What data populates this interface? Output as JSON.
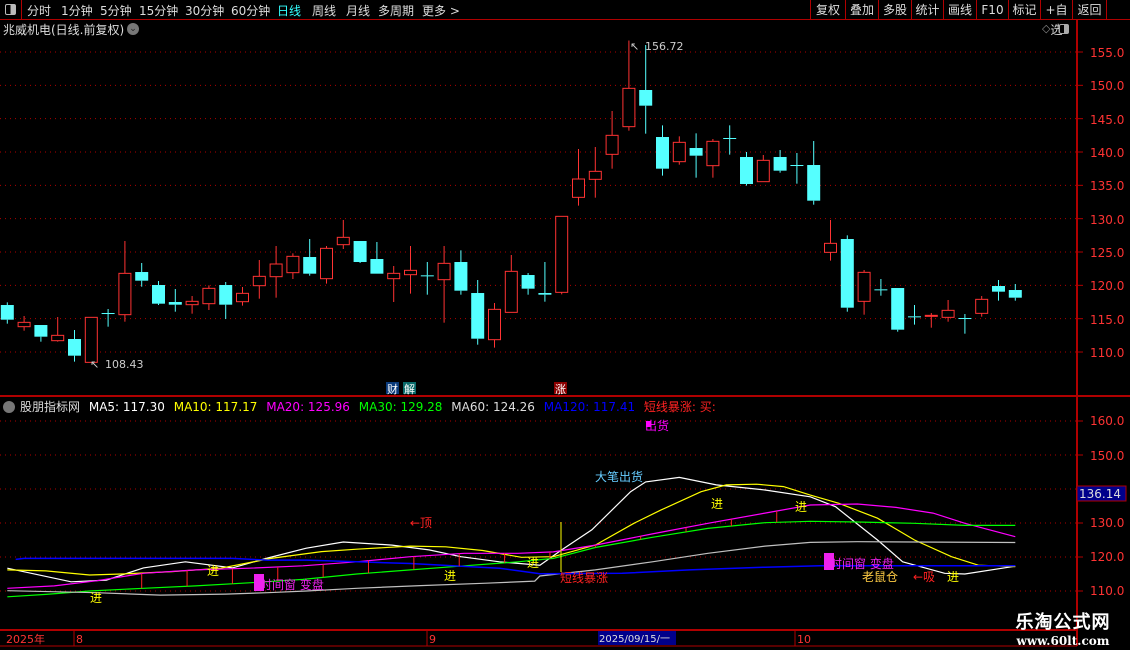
{
  "toolbar": {
    "periods": [
      "分时",
      "1分钟",
      "5分钟",
      "15分钟",
      "30分钟",
      "60分钟",
      "日线",
      "周线",
      "月线",
      "多周期",
      "更多 >"
    ],
    "active_period": "日线",
    "buttons": [
      "复权",
      "叠加",
      "多股",
      "统计",
      "画线",
      "F10",
      "标记",
      "+自选",
      "返回"
    ]
  },
  "main": {
    "title": "兆威机电(日线.前复权)",
    "high_label": "156.72",
    "low_label": "108.43",
    "event_badges": [
      "财",
      "解",
      "涨"
    ],
    "axis_ticks": [
      "155.0",
      "150.0",
      "145.0",
      "140.0",
      "135.0",
      "130.0",
      "125.0",
      "120.0",
      "115.0",
      "110.0"
    ]
  },
  "indicator": {
    "name": "股朋指标网",
    "ma": [
      {
        "label": "MA5: 117.30",
        "color": "#ffffff"
      },
      {
        "label": "MA10: 117.17",
        "color": "#ffff00"
      },
      {
        "label": "MA20: 125.96",
        "color": "#ff00ff"
      },
      {
        "label": "MA30: 129.28",
        "color": "#00ff00"
      },
      {
        "label": "MA60: 124.26",
        "color": "#c0c0c0"
      },
      {
        "label": "MA120: 117.41",
        "color": "#0000ff"
      }
    ],
    "signal_label": "短线暴涨: 买:",
    "axis_ticks": [
      "160.0",
      "150.0",
      "140.0",
      "130.0",
      "120.0",
      "110.0"
    ],
    "cursor_value": "136.14",
    "annotations": {
      "chu_huo": "出货",
      "da_bi_chu_huo": "大笔出货",
      "ding": "←顶",
      "jin": "进",
      "shi_jian_chuang": "时间窗 变盘",
      "duan_xian_bao_zhang": "短线暴涨",
      "lao_shu_cang": "老鼠仓",
      "xi": "←吸"
    }
  },
  "time_axis": {
    "year": "2025年",
    "months": [
      "8",
      "9",
      "10"
    ],
    "cursor_date": "2025/09/15/一"
  },
  "watermark": {
    "line1": "乐淘公式网",
    "line2": "www.60lt.com"
  },
  "colors": {
    "up": "#ff3333",
    "down": "#55ffff",
    "grid": "#b00000",
    "axis_text": "#ff3333",
    "cursor_box": "#00008b"
  },
  "chart_data": [
    {
      "type": "candlestick",
      "title": "兆威机电(日线.前复权)",
      "ylim": [
        105,
        158
      ],
      "fields": [
        "open",
        "high",
        "low",
        "close"
      ],
      "candles": [
        [
          117.05,
          117.45,
          114.25,
          114.85
        ],
        [
          113.8,
          115.4,
          113.2,
          114.45
        ],
        [
          114.05,
          114.05,
          111.55,
          112.3
        ],
        [
          111.7,
          115.25,
          111.55,
          112.5
        ],
        [
          111.95,
          113.3,
          108.55,
          109.45
        ],
        [
          108.45,
          115.2,
          108.43,
          115.2
        ],
        [
          115.85,
          116.45,
          113.8,
          115.75
        ],
        [
          115.6,
          126.65,
          114.55,
          121.8
        ],
        [
          122.0,
          123.35,
          119.8,
          120.7
        ],
        [
          120.05,
          120.65,
          117.05,
          117.25
        ],
        [
          117.5,
          119.45,
          116.05,
          117.1
        ],
        [
          117.1,
          118.4,
          115.75,
          117.6
        ],
        [
          117.25,
          120.0,
          116.3,
          119.55
        ],
        [
          120.05,
          120.5,
          114.95,
          117.1
        ],
        [
          117.55,
          119.75,
          116.95,
          118.8
        ],
        [
          119.95,
          123.8,
          118.0,
          121.35
        ],
        [
          121.3,
          125.9,
          118.15,
          123.2
        ],
        [
          121.9,
          124.8,
          120.95,
          124.35
        ],
        [
          124.25,
          126.95,
          121.45,
          121.75
        ],
        [
          121.0,
          125.9,
          120.25,
          125.55
        ],
        [
          126.1,
          129.8,
          125.45,
          127.2
        ],
        [
          126.65,
          126.65,
          123.35,
          123.5
        ],
        [
          123.95,
          126.5,
          121.75,
          121.75
        ],
        [
          121.0,
          122.9,
          117.5,
          121.8
        ],
        [
          121.6,
          125.9,
          118.75,
          122.25
        ],
        [
          121.5,
          123.5,
          118.6,
          121.4
        ],
        [
          120.85,
          125.9,
          114.4,
          123.3
        ],
        [
          123.5,
          125.25,
          118.6,
          119.2
        ],
        [
          118.85,
          120.8,
          111.1,
          112.0
        ],
        [
          111.85,
          117.35,
          110.65,
          116.4
        ],
        [
          115.95,
          124.55,
          115.95,
          122.1
        ],
        [
          121.55,
          121.85,
          118.6,
          119.5
        ],
        [
          118.85,
          123.5,
          117.55,
          118.6
        ],
        [
          118.95,
          130.35,
          118.65,
          130.35
        ],
        [
          133.2,
          140.45,
          131.95,
          135.95
        ],
        [
          135.9,
          140.75,
          133.15,
          137.1
        ],
        [
          139.65,
          146.15,
          137.5,
          142.5
        ],
        [
          143.8,
          156.72,
          143.2,
          149.55
        ],
        [
          149.3,
          156.05,
          142.75,
          146.95
        ],
        [
          142.25,
          144.0,
          136.45,
          137.5
        ],
        [
          138.55,
          142.35,
          138.1,
          141.45
        ],
        [
          140.6,
          142.8,
          136.15,
          139.45
        ],
        [
          137.95,
          141.95,
          136.15,
          141.6
        ],
        [
          142.1,
          144.0,
          139.6,
          142.0
        ],
        [
          139.25,
          140.0,
          134.95,
          135.2
        ],
        [
          135.55,
          139.55,
          135.55,
          138.75
        ],
        [
          139.25,
          140.3,
          136.9,
          137.2
        ],
        [
          138.05,
          139.85,
          135.25,
          138.0
        ],
        [
          138.05,
          141.65,
          132.1,
          132.7
        ],
        [
          124.95,
          129.8,
          123.7,
          126.3
        ],
        [
          126.95,
          127.5,
          116.05,
          116.65
        ],
        [
          117.6,
          122.3,
          115.6,
          121.95
        ],
        [
          119.4,
          120.95,
          118.45,
          119.35
        ],
        [
          119.6,
          119.6,
          113.05,
          113.35
        ],
        [
          115.35,
          117.05,
          114.1,
          115.3
        ],
        [
          115.45,
          115.85,
          113.65,
          115.5
        ],
        [
          115.2,
          117.8,
          114.55,
          116.25
        ],
        [
          115.1,
          115.7,
          112.75,
          115.05
        ],
        [
          115.8,
          118.4,
          115.3,
          117.9
        ],
        [
          119.9,
          120.8,
          117.7,
          119.05
        ],
        [
          119.3,
          120.2,
          117.7,
          118.15
        ]
      ]
    },
    {
      "type": "line",
      "title": "股朋指标网",
      "ylim": [
        105,
        163
      ],
      "x_unit": "bar index",
      "series": [
        {
          "name": "MA5",
          "color": "#ffffff",
          "points": [
            [
              0,
              116.7
            ],
            [
              3.8,
              112.7
            ],
            [
              5.9,
              113.2
            ],
            [
              8.1,
              116.8
            ],
            [
              10.6,
              118.6
            ],
            [
              13.4,
              116.8
            ],
            [
              15.5,
              119.7
            ],
            [
              17.8,
              122.6
            ],
            [
              20,
              124.4
            ],
            [
              22.9,
              123.5
            ],
            [
              25.1,
              122.1
            ],
            [
              27,
              120.1
            ],
            [
              29.3,
              118.6
            ],
            [
              31.7,
              117.6
            ],
            [
              33,
              122.1
            ],
            [
              34.8,
              128
            ],
            [
              37.1,
              139.2
            ],
            [
              38,
              142.1
            ],
            [
              40,
              143.4
            ],
            [
              42.2,
              141.2
            ],
            [
              45.1,
              139.7
            ],
            [
              47.8,
              137.7
            ],
            [
              49.3,
              134.8
            ],
            [
              51.8,
              125
            ],
            [
              53.3,
              118.6
            ],
            [
              55.8,
              115.2
            ],
            [
              57,
              115
            ],
            [
              60,
              117.3
            ]
          ]
        },
        {
          "name": "MA10",
          "color": "#ffff00",
          "points": [
            [
              0,
              116.2
            ],
            [
              2.3,
              115.9
            ],
            [
              4.9,
              114.7
            ],
            [
              6.8,
              115
            ],
            [
              9.8,
              115.7
            ],
            [
              12.7,
              116.7
            ],
            [
              15.7,
              119.6
            ],
            [
              18.7,
              121.6
            ],
            [
              20.8,
              122.3
            ],
            [
              24,
              123.2
            ],
            [
              26.1,
              123
            ],
            [
              28.3,
              121.9
            ],
            [
              30.6,
              119.9
            ],
            [
              32.5,
              120.1
            ],
            [
              35,
              123.5
            ],
            [
              37.3,
              129.9
            ],
            [
              38.9,
              133.8
            ],
            [
              41.3,
              139.2
            ],
            [
              42.8,
              141.2
            ],
            [
              44.6,
              141.4
            ],
            [
              46.2,
              140.7
            ],
            [
              47.8,
              138.2
            ],
            [
              49.5,
              135.8
            ],
            [
              51.8,
              131.4
            ],
            [
              54,
              125
            ],
            [
              56.2,
              120.1
            ],
            [
              57.8,
              117.6
            ],
            [
              60,
              117.17
            ]
          ]
        },
        {
          "name": "MA20",
          "color": "#ff00ff",
          "points": [
            [
              0,
              110.8
            ],
            [
              2.8,
              111.5
            ],
            [
              5.3,
              113
            ],
            [
              8.1,
              115.2
            ],
            [
              11.2,
              116.2
            ],
            [
              14.4,
              116.7
            ],
            [
              17.6,
              117.4
            ],
            [
              20.8,
              118.6
            ],
            [
              24,
              120.1
            ],
            [
              27.2,
              121.1
            ],
            [
              30.4,
              121.1
            ],
            [
              32.5,
              121.5
            ],
            [
              35,
              123.5
            ],
            [
              38.4,
              126.8
            ],
            [
              41.7,
              129.9
            ],
            [
              45.1,
              132.9
            ],
            [
              47.8,
              135.3
            ],
            [
              50.6,
              135.6
            ],
            [
              52.9,
              134.6
            ],
            [
              55.1,
              132.9
            ],
            [
              57,
              129.9
            ],
            [
              60,
              125.96
            ]
          ]
        },
        {
          "name": "MA30",
          "color": "#00ff00",
          "points": [
            [
              0,
              108.3
            ],
            [
              2.3,
              109
            ],
            [
              4.9,
              110
            ],
            [
              8.1,
              110.8
            ],
            [
              11.2,
              111.5
            ],
            [
              14.4,
              112.4
            ],
            [
              17.6,
              113.4
            ],
            [
              20.8,
              115
            ],
            [
              24,
              116.2
            ],
            [
              27.2,
              117.4
            ],
            [
              30.4,
              118.6
            ],
            [
              32.5,
              119.6
            ],
            [
              35,
              122.8
            ],
            [
              38.4,
              125.8
            ],
            [
              41.7,
              128.4
            ],
            [
              45.1,
              130.1
            ],
            [
              47.8,
              130.5
            ],
            [
              50.6,
              130.3
            ],
            [
              54,
              129.9
            ],
            [
              57,
              129.3
            ],
            [
              60,
              129.28
            ]
          ]
        },
        {
          "name": "MA60",
          "color": "#c0c0c0",
          "points": [
            [
              0,
              110.1
            ],
            [
              5.3,
              109.5
            ],
            [
              9.1,
              108.8
            ],
            [
              13,
              109.1
            ],
            [
              15.5,
              109.5
            ],
            [
              17.8,
              110
            ],
            [
              20.8,
              110.8
            ],
            [
              24.6,
              111.6
            ],
            [
              28.5,
              112.3
            ],
            [
              31.4,
              112.9
            ],
            [
              31.7,
              114.4
            ],
            [
              35,
              116.2
            ],
            [
              38.4,
              118.6
            ],
            [
              41.7,
              121.1
            ],
            [
              45.1,
              123.2
            ],
            [
              47.8,
              124.3
            ],
            [
              50.6,
              124.5
            ],
            [
              60,
              124.26
            ]
          ]
        },
        {
          "name": "MA120",
          "color": "#0000ff",
          "points": [
            [
              0.5,
              119.3
            ],
            [
              1,
              119.6
            ],
            [
              13.4,
              119.6
            ],
            [
              15.5,
              119.1
            ],
            [
              17.8,
              119.1
            ],
            [
              20.8,
              118.6
            ],
            [
              24,
              118.1
            ],
            [
              26.5,
              117.4
            ],
            [
              29.3,
              116.7
            ],
            [
              31.7,
              115.1
            ],
            [
              36.6,
              115.2
            ],
            [
              40.6,
              116.2
            ],
            [
              45.1,
              117
            ],
            [
              48.4,
              117.4
            ],
            [
              60,
              117.41
            ]
          ]
        }
      ]
    }
  ]
}
